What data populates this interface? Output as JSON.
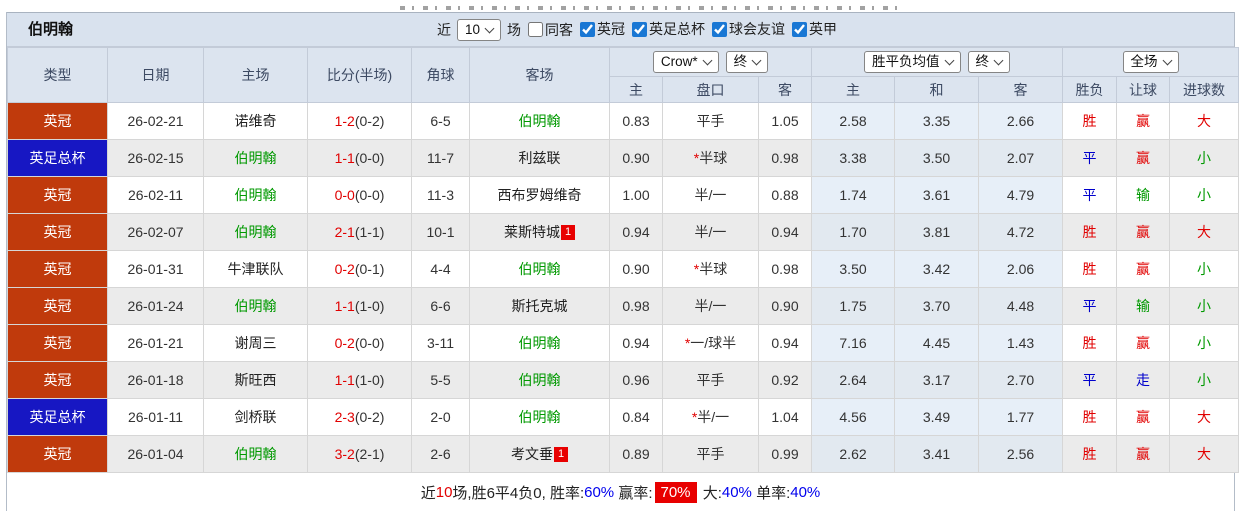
{
  "colors": {
    "league_red_bg": "#c03a0c",
    "league_blue_bg": "#1717c3",
    "checkbox_accent": "#1977d4",
    "text_red": "#e10000",
    "text_blue": "#0000cc",
    "text_green": "#009900",
    "summary_badge_bg": "#e80000",
    "header_bg": "#dce4ef"
  },
  "title_bar": {
    "team": "伯明翰",
    "recent_label": "近",
    "matches_count": "10",
    "matches_label": "场",
    "same_away_label": "同客",
    "same_away_checked": false,
    "filters": [
      {
        "label": "英冠",
        "checked": true
      },
      {
        "label": "英足总杯",
        "checked": true
      },
      {
        "label": "球会友谊",
        "checked": true
      },
      {
        "label": "英甲",
        "checked": true
      }
    ]
  },
  "header": {
    "cols": [
      "类型",
      "日期",
      "主场",
      "比分(半场)",
      "角球",
      "客场"
    ],
    "odds_select": "Crow*",
    "final_select": "终",
    "avg_select": "胜平负均值",
    "full_select": "全场",
    "sub": [
      "主",
      "盘口",
      "客",
      "主",
      "和",
      "客",
      "胜负",
      "让球",
      "进球数"
    ]
  },
  "rows": [
    {
      "league": "英冠",
      "league_style": "red",
      "date": "26-02-21",
      "home": "诺维奇",
      "home_is_team": false,
      "home_badge": "",
      "score_ft": "1-2",
      "score_ht": "(0-2)",
      "corners": "6-5",
      "away": "伯明翰",
      "away_is_team": true,
      "away_badge": "",
      "odds_home": "0.83",
      "handicap_star": false,
      "handicap": "平手",
      "odds_away": "1.05",
      "avg_home": "2.58",
      "avg_draw": "3.35",
      "avg_away": "2.66",
      "res_wdl": "胜",
      "res_wdl_style": "red",
      "res_handicap": "赢",
      "res_handicap_style": "red",
      "res_goals": "大",
      "res_goals_style": "red"
    },
    {
      "league": "英足总杯",
      "league_style": "blue",
      "date": "26-02-15",
      "home": "伯明翰",
      "home_is_team": true,
      "home_badge": "",
      "score_ft": "1-1",
      "score_ht": "(0-0)",
      "corners": "11-7",
      "away": "利兹联",
      "away_is_team": false,
      "away_badge": "",
      "odds_home": "0.90",
      "handicap_star": true,
      "handicap": "半球",
      "odds_away": "0.98",
      "avg_home": "3.38",
      "avg_draw": "3.50",
      "avg_away": "2.07",
      "res_wdl": "平",
      "res_wdl_style": "blue",
      "res_handicap": "赢",
      "res_handicap_style": "red",
      "res_goals": "小",
      "res_goals_style": "green"
    },
    {
      "league": "英冠",
      "league_style": "red",
      "date": "26-02-11",
      "home": "伯明翰",
      "home_is_team": true,
      "home_badge": "",
      "score_ft": "0-0",
      "score_ht": "(0-0)",
      "corners": "11-3",
      "away": "西布罗姆维奇",
      "away_is_team": false,
      "away_badge": "",
      "odds_home": "1.00",
      "handicap_star": false,
      "handicap": "半/一",
      "odds_away": "0.88",
      "avg_home": "1.74",
      "avg_draw": "3.61",
      "avg_away": "4.79",
      "res_wdl": "平",
      "res_wdl_style": "blue",
      "res_handicap": "输",
      "res_handicap_style": "green",
      "res_goals": "小",
      "res_goals_style": "green"
    },
    {
      "league": "英冠",
      "league_style": "red",
      "date": "26-02-07",
      "home": "伯明翰",
      "home_is_team": true,
      "home_badge": "",
      "score_ft": "2-1",
      "score_ht": "(1-1)",
      "corners": "10-1",
      "away": "莱斯特城",
      "away_is_team": false,
      "away_badge": "1",
      "odds_home": "0.94",
      "handicap_star": false,
      "handicap": "半/一",
      "odds_away": "0.94",
      "avg_home": "1.70",
      "avg_draw": "3.81",
      "avg_away": "4.72",
      "res_wdl": "胜",
      "res_wdl_style": "red",
      "res_handicap": "赢",
      "res_handicap_style": "red",
      "res_goals": "大",
      "res_goals_style": "red"
    },
    {
      "league": "英冠",
      "league_style": "red",
      "date": "26-01-31",
      "home": "牛津联队",
      "home_is_team": false,
      "home_badge": "",
      "score_ft": "0-2",
      "score_ht": "(0-1)",
      "corners": "4-4",
      "away": "伯明翰",
      "away_is_team": true,
      "away_badge": "",
      "odds_home": "0.90",
      "handicap_star": true,
      "handicap": "半球",
      "odds_away": "0.98",
      "avg_home": "3.50",
      "avg_draw": "3.42",
      "avg_away": "2.06",
      "res_wdl": "胜",
      "res_wdl_style": "red",
      "res_handicap": "赢",
      "res_handicap_style": "red",
      "res_goals": "小",
      "res_goals_style": "green"
    },
    {
      "league": "英冠",
      "league_style": "red",
      "date": "26-01-24",
      "home": "伯明翰",
      "home_is_team": true,
      "home_badge": "",
      "score_ft": "1-1",
      "score_ht": "(1-0)",
      "corners": "6-6",
      "away": "斯托克城",
      "away_is_team": false,
      "away_badge": "",
      "odds_home": "0.98",
      "handicap_star": false,
      "handicap": "半/一",
      "odds_away": "0.90",
      "avg_home": "1.75",
      "avg_draw": "3.70",
      "avg_away": "4.48",
      "res_wdl": "平",
      "res_wdl_style": "blue",
      "res_handicap": "输",
      "res_handicap_style": "green",
      "res_goals": "小",
      "res_goals_style": "green"
    },
    {
      "league": "英冠",
      "league_style": "red",
      "date": "26-01-21",
      "home": "谢周三",
      "home_is_team": false,
      "home_badge": "",
      "score_ft": "0-2",
      "score_ht": "(0-0)",
      "corners": "3-11",
      "away": "伯明翰",
      "away_is_team": true,
      "away_badge": "",
      "odds_home": "0.94",
      "handicap_star": true,
      "handicap": "一/球半",
      "odds_away": "0.94",
      "avg_home": "7.16",
      "avg_draw": "4.45",
      "avg_away": "1.43",
      "res_wdl": "胜",
      "res_wdl_style": "red",
      "res_handicap": "赢",
      "res_handicap_style": "red",
      "res_goals": "小",
      "res_goals_style": "green"
    },
    {
      "league": "英冠",
      "league_style": "red",
      "date": "26-01-18",
      "home": "斯旺西",
      "home_is_team": false,
      "home_badge": "",
      "score_ft": "1-1",
      "score_ht": "(1-0)",
      "corners": "5-5",
      "away": "伯明翰",
      "away_is_team": true,
      "away_badge": "",
      "odds_home": "0.96",
      "handicap_star": false,
      "handicap": "平手",
      "odds_away": "0.92",
      "avg_home": "2.64",
      "avg_draw": "3.17",
      "avg_away": "2.70",
      "res_wdl": "平",
      "res_wdl_style": "blue",
      "res_handicap": "走",
      "res_handicap_style": "blue",
      "res_goals": "小",
      "res_goals_style": "green"
    },
    {
      "league": "英足总杯",
      "league_style": "blue",
      "date": "26-01-11",
      "home": "剑桥联",
      "home_is_team": false,
      "home_badge": "",
      "score_ft": "2-3",
      "score_ht": "(0-2)",
      "corners": "2-0",
      "away": "伯明翰",
      "away_is_team": true,
      "away_badge": "",
      "odds_home": "0.84",
      "handicap_star": true,
      "handicap": "半/一",
      "odds_away": "1.04",
      "avg_home": "4.56",
      "avg_draw": "3.49",
      "avg_away": "1.77",
      "res_wdl": "胜",
      "res_wdl_style": "red",
      "res_handicap": "赢",
      "res_handicap_style": "red",
      "res_goals": "大",
      "res_goals_style": "red"
    },
    {
      "league": "英冠",
      "league_style": "red",
      "date": "26-01-04",
      "home": "伯明翰",
      "home_is_team": true,
      "home_badge": "",
      "score_ft": "3-2",
      "score_ht": "(2-1)",
      "corners": "2-6",
      "away": "考文垂",
      "away_is_team": false,
      "away_badge": "1",
      "odds_home": "0.89",
      "handicap_star": false,
      "handicap": "平手",
      "odds_away": "0.99",
      "avg_home": "2.62",
      "avg_draw": "3.41",
      "avg_away": "2.56",
      "res_wdl": "胜",
      "res_wdl_style": "red",
      "res_handicap": "赢",
      "res_handicap_style": "red",
      "res_goals": "大",
      "res_goals_style": "red"
    }
  ],
  "summary": {
    "segments": [
      {
        "text": "近",
        "style": "plain"
      },
      {
        "text": "10",
        "style": "red"
      },
      {
        "text": "场,胜6平4负0, 胜率:",
        "style": "plain"
      },
      {
        "text": "60%",
        "style": "blue"
      },
      {
        "text": " 赢率:",
        "style": "plain"
      },
      {
        "text": "70%",
        "style": "badge"
      },
      {
        "text": " 大:",
        "style": "plain"
      },
      {
        "text": "40%",
        "style": "blue"
      },
      {
        "text": " 单率:",
        "style": "plain"
      },
      {
        "text": "40%",
        "style": "blue"
      }
    ]
  }
}
